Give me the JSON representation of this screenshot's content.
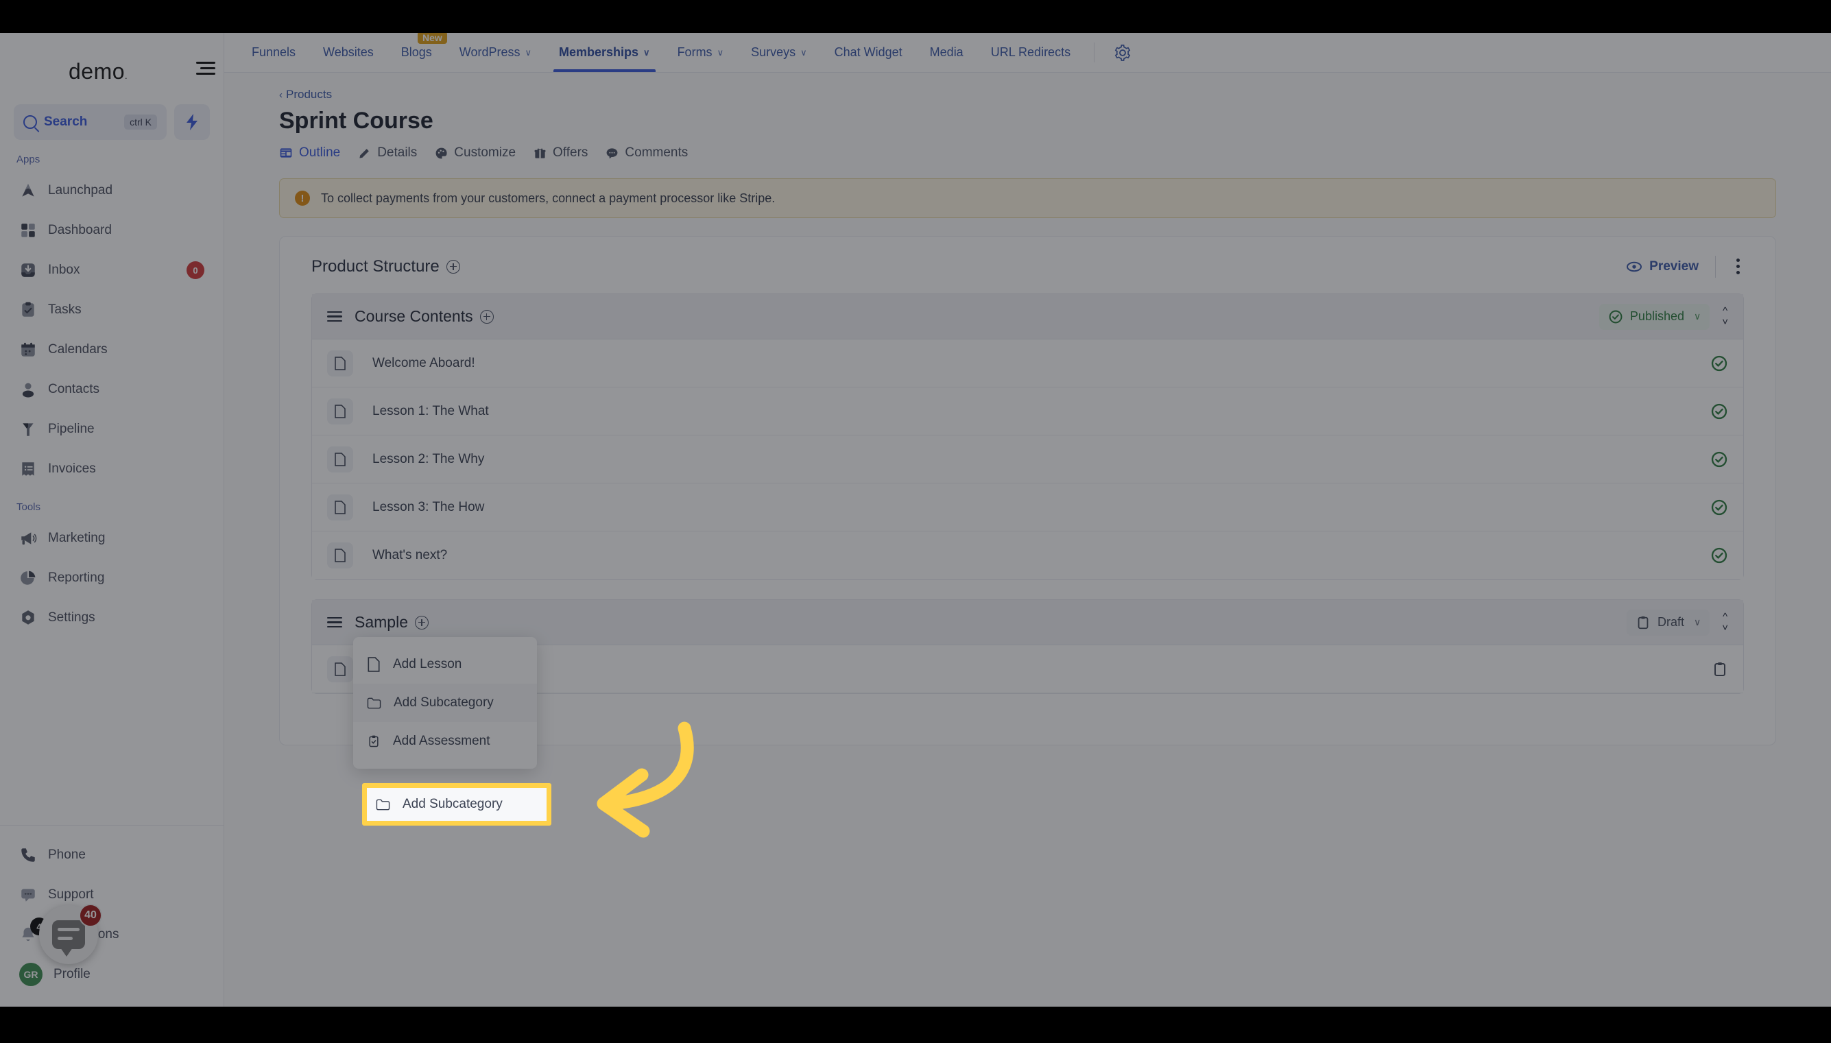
{
  "brand": {
    "logo": "demo",
    "logo_dot": "."
  },
  "sidebar": {
    "search": {
      "label": "Search",
      "shortcut": "ctrl K"
    },
    "groups": [
      {
        "label": "Apps",
        "items": [
          {
            "label": "Launchpad",
            "icon": "launchpad-icon",
            "badge": null
          },
          {
            "label": "Dashboard",
            "icon": "dashboard-icon",
            "badge": null
          },
          {
            "label": "Inbox",
            "icon": "inbox-icon",
            "badge": "0"
          },
          {
            "label": "Tasks",
            "icon": "tasks-icon",
            "badge": null
          },
          {
            "label": "Calendars",
            "icon": "calendar-icon",
            "badge": null
          },
          {
            "label": "Contacts",
            "icon": "contacts-icon",
            "badge": null
          },
          {
            "label": "Pipeline",
            "icon": "pipeline-icon",
            "badge": null
          },
          {
            "label": "Invoices",
            "icon": "invoices-icon",
            "badge": null
          }
        ]
      },
      {
        "label": "Tools",
        "items": [
          {
            "label": "Marketing",
            "icon": "megaphone-icon",
            "badge": null
          },
          {
            "label": "Reporting",
            "icon": "pie-chart-icon",
            "badge": null
          },
          {
            "label": "Settings",
            "icon": "gear-icon",
            "badge": null
          }
        ]
      }
    ],
    "bottom": [
      {
        "label": "Phone",
        "icon": "phone-icon",
        "badge": null
      },
      {
        "label": "Support",
        "icon": "support-chat-icon",
        "badge": null
      },
      {
        "label": "Notifications",
        "icon": "bell-icon",
        "badge": "4"
      },
      {
        "label": "Profile",
        "icon": "avatar-icon",
        "avatar_initials": "GR"
      }
    ]
  },
  "chat_widget": {
    "badge": "40",
    "name": "chat-launcher"
  },
  "topnav": {
    "items": [
      {
        "label": "Funnels",
        "caret": false,
        "badge": null,
        "active": false
      },
      {
        "label": "Websites",
        "caret": false,
        "badge": null,
        "active": false
      },
      {
        "label": "Blogs",
        "caret": false,
        "badge": "New",
        "active": false
      },
      {
        "label": "WordPress",
        "caret": true,
        "badge": null,
        "active": false
      },
      {
        "label": "Memberships",
        "caret": true,
        "badge": null,
        "active": true
      },
      {
        "label": "Forms",
        "caret": true,
        "badge": null,
        "active": false
      },
      {
        "label": "Surveys",
        "caret": true,
        "badge": null,
        "active": false
      },
      {
        "label": "Chat Widget",
        "caret": false,
        "badge": null,
        "active": false
      },
      {
        "label": "Media",
        "caret": false,
        "badge": null,
        "active": false
      },
      {
        "label": "URL Redirects",
        "caret": false,
        "badge": null,
        "active": false
      }
    ],
    "settings_icon": "gear-icon",
    "caret_glyph": "∨"
  },
  "page": {
    "breadcrumb": "Products",
    "breadcrumb_chevron": "‹",
    "title": "Sprint Course",
    "tabs": [
      {
        "label": "Outline",
        "icon": "grid-icon",
        "active": true
      },
      {
        "label": "Details",
        "icon": "pencil-icon",
        "active": false
      },
      {
        "label": "Customize",
        "icon": "palette-icon",
        "active": false
      },
      {
        "label": "Offers",
        "icon": "gift-icon",
        "active": false
      },
      {
        "label": "Comments",
        "icon": "comment-icon",
        "active": false
      }
    ],
    "banner": {
      "icon": "warning-icon",
      "icon_glyph": "!",
      "text": "To collect payments from your customers, connect a payment processor like Stripe."
    }
  },
  "product_structure": {
    "title": "Product Structure",
    "add_icon": "plus-circle-icon",
    "preview_label": "Preview",
    "preview_icon": "eye-icon",
    "kebab_icon": "more-vertical-icon",
    "sections": [
      {
        "title": "Course Contents",
        "add_icon": "plus-circle-icon",
        "drag_icon": "drag-handle-icon",
        "status": {
          "label": "Published",
          "icon": "check-circle-icon",
          "variant": "published",
          "caret": "∨"
        },
        "reorder_icon": "sort-updown-icon",
        "rows": [
          {
            "name": "Welcome Aboard!",
            "icon": "document-icon",
            "status_icon": "check-circle-icon"
          },
          {
            "name": "Lesson 1: The What",
            "icon": "document-icon",
            "status_icon": "check-circle-icon"
          },
          {
            "name": "Lesson 2: The Why",
            "icon": "document-icon",
            "status_icon": "check-circle-icon"
          },
          {
            "name": "Lesson 3: The How",
            "icon": "document-icon",
            "status_icon": "check-circle-icon"
          },
          {
            "name": "What's next?",
            "icon": "document-icon",
            "status_icon": "check-circle-icon"
          }
        ]
      },
      {
        "title": "Sample",
        "add_icon": "plus-circle-icon",
        "drag_icon": "drag-handle-icon",
        "status": {
          "label": "Draft",
          "icon": "clipboard-icon",
          "variant": "draft",
          "caret": "∨"
        },
        "reorder_icon": "sort-updown-icon",
        "rows": [
          {
            "name": "",
            "icon": "document-icon",
            "status_icon": "clipboard-icon"
          }
        ]
      }
    ]
  },
  "dropdown": {
    "name": "add-content-menu",
    "items": [
      {
        "label": "Add Lesson",
        "icon": "document-icon",
        "highlighted": false
      },
      {
        "label": "Add Subcategory",
        "icon": "folder-icon",
        "highlighted": true
      },
      {
        "label": "Add Assessment",
        "icon": "clipboard-check-icon",
        "highlighted": false
      }
    ]
  },
  "annotation": {
    "highlight_color": "#ffd24a",
    "arrow_color": "#ffd24a",
    "target_label": "Add Subcategory"
  },
  "colors": {
    "accent_blue": "#3b5bdb",
    "published_green": "#2f7d42",
    "warning_amber": "#e08c14",
    "badge_red": "#d13c3c",
    "highlight_yellow": "#ffd24a"
  }
}
